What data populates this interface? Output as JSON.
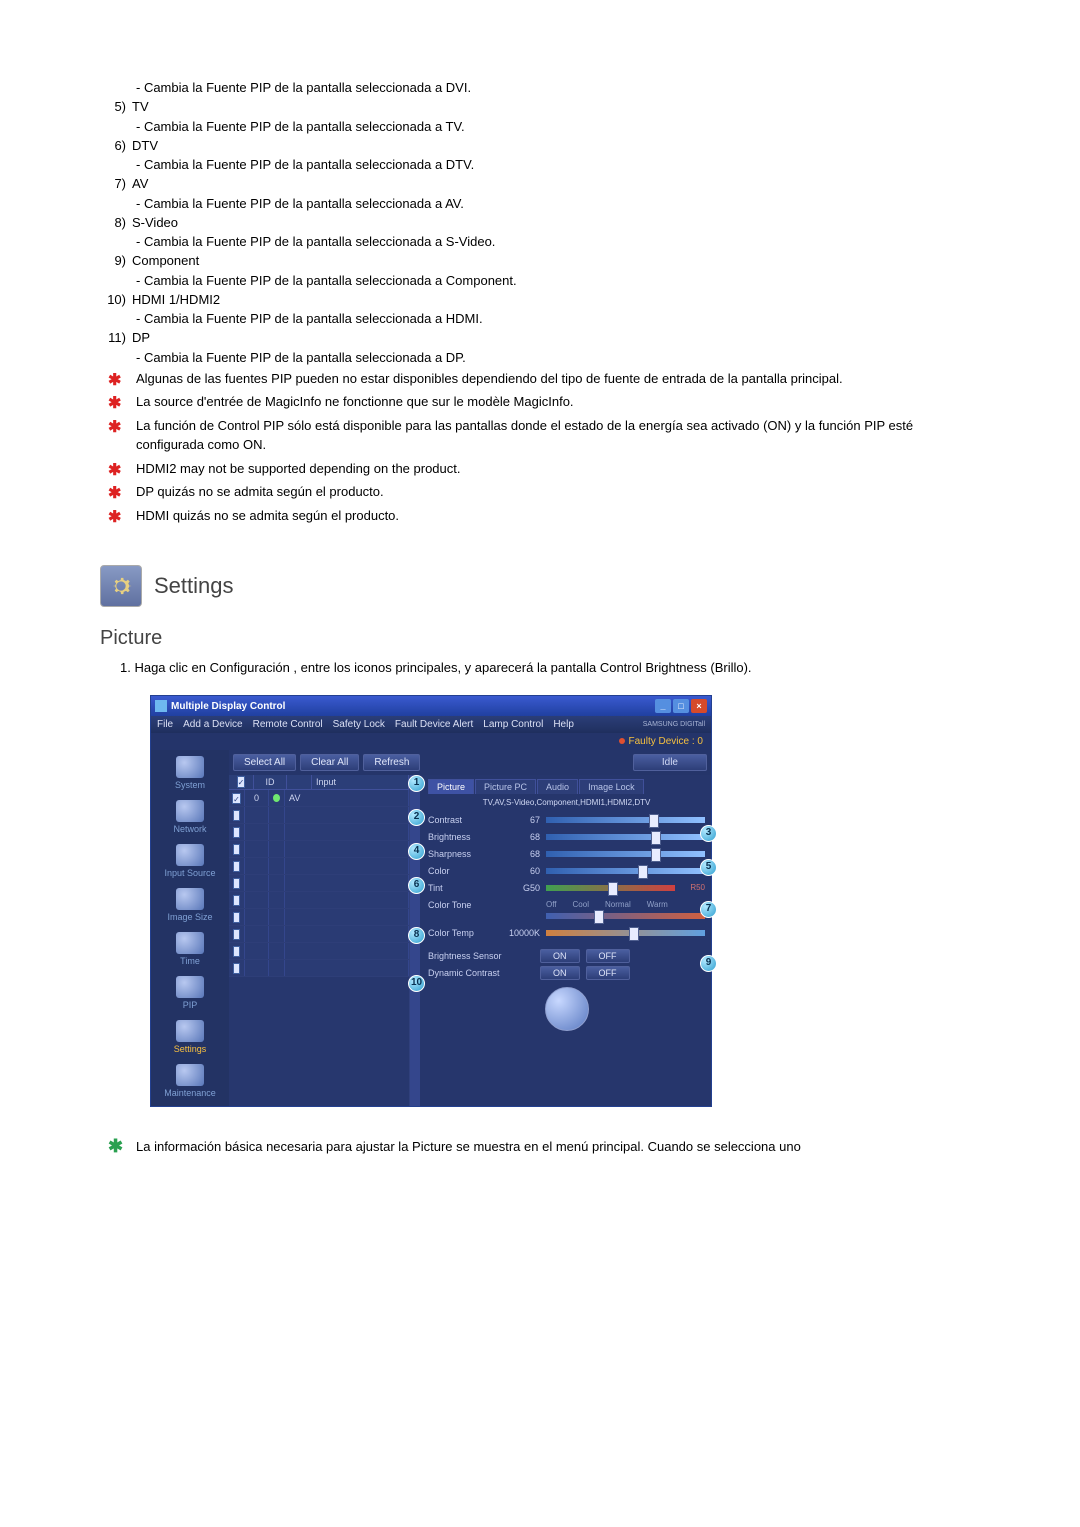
{
  "top_desc": "- Cambia la Fuente PIP de la pantalla seleccionada a DVI.",
  "items": [
    {
      "num": "5)",
      "label": "TV",
      "desc": "- Cambia la Fuente PIP de la pantalla seleccionada a TV."
    },
    {
      "num": "6)",
      "label": "DTV",
      "desc": "- Cambia la Fuente PIP de la pantalla seleccionada a DTV."
    },
    {
      "num": "7)",
      "label": "AV",
      "desc": "- Cambia la Fuente PIP de la pantalla seleccionada a AV."
    },
    {
      "num": "8)",
      "label": "S-Video",
      "desc": "- Cambia la Fuente PIP de la pantalla seleccionada a S-Video."
    },
    {
      "num": "9)",
      "label": "Component",
      "desc": "- Cambia la Fuente PIP de la pantalla seleccionada a Component."
    },
    {
      "num": "10)",
      "label": "HDMI 1/HDMI2",
      "desc": "- Cambia la Fuente PIP de la pantalla seleccionada a HDMI."
    },
    {
      "num": "11)",
      "label": "DP",
      "desc": "- Cambia la Fuente PIP de la pantalla seleccionada a DP."
    }
  ],
  "notes": [
    "Algunas de las fuentes PIP pueden no estar disponibles dependiendo del tipo de fuente de entrada de la pantalla principal.",
    "La source d'entrée de MagicInfo ne fonctionne que sur le modèle MagicInfo.",
    "La función de Control PIP sólo está disponible para las pantallas donde el estado de la energía sea activado (ON) y la función PIP esté configurada como ON.",
    "HDMI2 may not be supported depending on the product.",
    "DP quizás no se admita según el producto.",
    "HDMI quizás no se admita según el producto."
  ],
  "section_title": "Settings",
  "sub_title": "Picture",
  "step1": "1.   Haga clic en Configuración , entre los iconos principales, y aparecerá la pantalla Control Brightness (Brillo).",
  "mdc": {
    "title": "Multiple Display Control",
    "menus": [
      "File",
      "Add a Device",
      "Remote Control",
      "Safety Lock",
      "Fault Device Alert",
      "Lamp Control",
      "Help"
    ],
    "brand": "SAMSUNG DIGITall",
    "faulty": "Faulty Device : 0",
    "toolbar": {
      "select": "Select All",
      "clear": "Clear All",
      "refresh": "Refresh",
      "idle": "Idle"
    },
    "sidebar": [
      "System",
      "Network",
      "Input Source",
      "Image Size",
      "Time",
      "PIP",
      "Settings",
      "Maintenance"
    ],
    "grid": {
      "head": [
        "",
        "ID",
        "",
        "Input"
      ],
      "row": {
        "id": "0",
        "input": "AV"
      }
    },
    "tabs": [
      "Picture",
      "Picture PC",
      "Audio",
      "Image Lock"
    ],
    "infoline": "TV,AV,S-Video,Component,HDMI1,HDMI2,DTV",
    "sliders": [
      {
        "label": "Contrast",
        "val": "67"
      },
      {
        "label": "Brightness",
        "val": "68"
      },
      {
        "label": "Sharpness",
        "val": "68"
      },
      {
        "label": "Color",
        "val": "60"
      },
      {
        "label": "Tint",
        "val": "G50",
        "right": "R50"
      }
    ],
    "colortone": {
      "label": "Color Tone",
      "opts": [
        "Off",
        "Cool",
        "Normal",
        "Warm"
      ]
    },
    "colortemp": {
      "label": "Color Temp",
      "val": "10000K"
    },
    "bsensor": {
      "label": "Brightness Sensor",
      "on": "ON",
      "off": "OFF"
    },
    "dcontrast": {
      "label": "Dynamic Contrast",
      "on": "ON",
      "off": "OFF"
    }
  },
  "footer": "La información básica necesaria para ajustar la Picture se muestra en el menú principal. Cuando se selecciona uno"
}
